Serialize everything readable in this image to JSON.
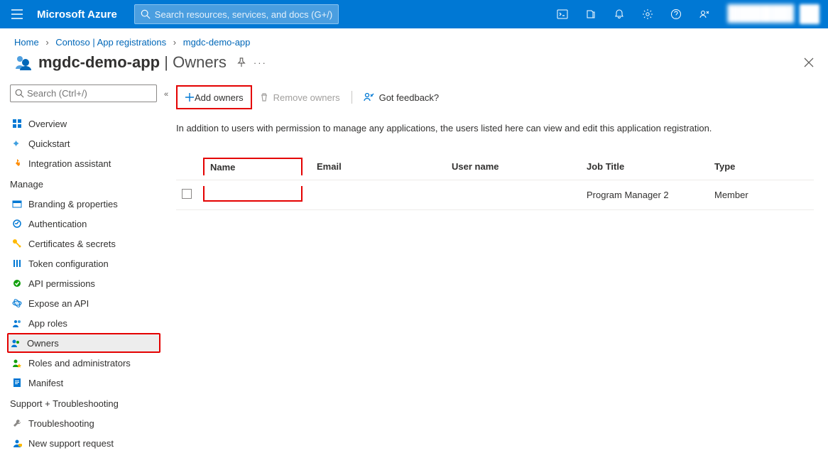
{
  "topbar": {
    "brand": "Microsoft Azure",
    "search_placeholder": "Search resources, services, and docs (G+/)",
    "account_name": "████████████",
    "account_dir": "████████████"
  },
  "breadcrumb": {
    "items": [
      "Home",
      "Contoso | App registrations",
      "mgdc-demo-app"
    ]
  },
  "page": {
    "title_app": "mgdc-demo-app",
    "title_section": "Owners"
  },
  "sidebar": {
    "search_placeholder": "Search (Ctrl+/)",
    "top_items": [
      {
        "label": "Overview",
        "icon": "overview",
        "color": "#0078d4"
      },
      {
        "label": "Quickstart",
        "icon": "quickstart",
        "color": "#0078d4"
      },
      {
        "label": "Integration assistant",
        "icon": "rocket",
        "color": "#ff8c00"
      }
    ],
    "manage_label": "Manage",
    "manage_items": [
      {
        "label": "Branding & properties",
        "icon": "branding",
        "color": "#0078d4"
      },
      {
        "label": "Authentication",
        "icon": "auth",
        "color": "#0078d4"
      },
      {
        "label": "Certificates & secrets",
        "icon": "key",
        "color": "#ffb900"
      },
      {
        "label": "Token configuration",
        "icon": "token",
        "color": "#0078d4"
      },
      {
        "label": "API permissions",
        "icon": "api-perm",
        "color": "#0aa353"
      },
      {
        "label": "Expose an API",
        "icon": "expose",
        "color": "#0078d4"
      },
      {
        "label": "App roles",
        "icon": "app-roles",
        "color": "#0078d4"
      },
      {
        "label": "Owners",
        "icon": "owners",
        "color": "#0078d4",
        "selected": true
      },
      {
        "label": "Roles and administrators",
        "icon": "roles",
        "color": "#0aa353"
      },
      {
        "label": "Manifest",
        "icon": "manifest",
        "color": "#0078d4"
      }
    ],
    "support_label": "Support + Troubleshooting",
    "support_items": [
      {
        "label": "Troubleshooting",
        "icon": "wrench",
        "color": "#605e5c"
      },
      {
        "label": "New support request",
        "icon": "support",
        "color": "#0078d4"
      }
    ]
  },
  "toolbar": {
    "add_label": "Add owners",
    "remove_label": "Remove owners",
    "feedback_label": "Got feedback?"
  },
  "main": {
    "description": "In addition to users with permission to manage any applications, the users listed here can view and edit this application registration."
  },
  "table": {
    "headers": {
      "name": "Name",
      "email": "Email",
      "username": "User name",
      "jobtitle": "Job Title",
      "type": "Type"
    },
    "rows": [
      {
        "name": "",
        "email": "",
        "username": "",
        "jobtitle": "Program Manager 2",
        "type": "Member"
      }
    ]
  }
}
